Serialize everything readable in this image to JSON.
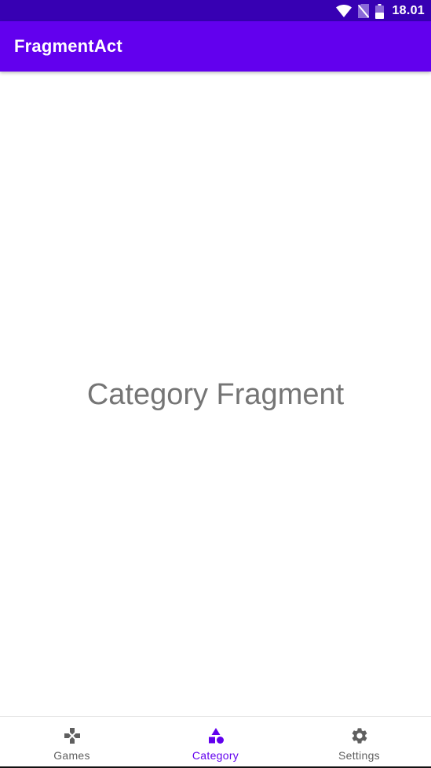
{
  "status_bar": {
    "time": "18.01",
    "icons": [
      "wifi-icon",
      "no-sim-icon",
      "battery-icon"
    ],
    "background": "#3700b3"
  },
  "app_bar": {
    "title": "FragmentAct",
    "background": "#6200ee"
  },
  "content": {
    "text": "Category Fragment"
  },
  "bottom_nav": {
    "items": [
      {
        "label": "Games",
        "icon": "gamepad-icon",
        "active": false
      },
      {
        "label": "Category",
        "icon": "category-icon",
        "active": true
      },
      {
        "label": "Settings",
        "icon": "gear-icon",
        "active": false
      }
    ],
    "active_color": "#6200ee",
    "inactive_color": "#5f5f5f"
  }
}
